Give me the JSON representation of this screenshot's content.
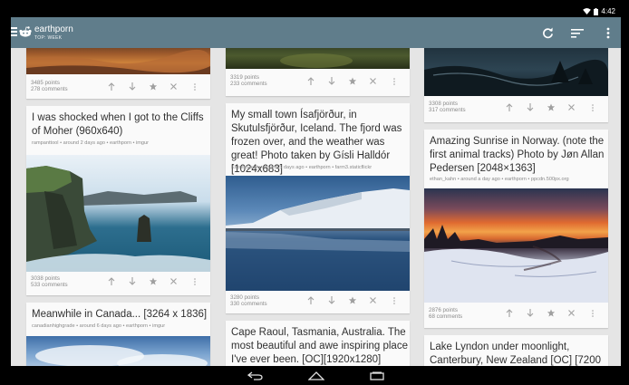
{
  "status": {
    "time": "4:42"
  },
  "appbar": {
    "title": "earthporn",
    "subtitle": "TOP: WEEK"
  },
  "colors": {
    "appbar": "#607d8b",
    "card": "#fafafa",
    "background": "#e5e5e5",
    "text": "#303030",
    "muted": "#8a8a8a"
  },
  "icons": [
    "menu-icon",
    "reddit-alien-icon",
    "refresh-icon",
    "sort-icon",
    "overflow-menu-icon",
    "upvote-icon",
    "downvote-icon",
    "star-icon",
    "close-icon",
    "more-icon",
    "back-icon",
    "home-icon",
    "recents-icon",
    "wifi-icon",
    "battery-icon"
  ],
  "posts": [
    {
      "points": "3485 points",
      "comments": "278 comments"
    },
    {
      "title": "I was shocked when I got to the Cliffs of Moher (960x640)",
      "meta": "rampanttool • around 2 days ago • earthporn • imgur",
      "points": "3038 points",
      "comments": "533 comments"
    },
    {
      "title": "Meanwhile in Canada... [3264 x 1836]",
      "meta": "canadianhighgrade • around 6 days ago • earthporn • imgur"
    },
    {
      "points": "3319 points",
      "comments": "233 comments"
    },
    {
      "title": "My small town Ísafjörður, in Skutulsfjörður, Iceland. The fjord was frozen over, and the weather was great! Photo taken by Gísli Halldór [1024x683]",
      "meta": "KaiserGauti • around 5 days ago • earthporn • farm3.staticflickr",
      "points": "3280 points",
      "comments": "330 comments"
    },
    {
      "title": "Cape Raoul, Tasmania, Australia. The most beautiful and awe inspiring place I've ever been. [OC][1920x1280]"
    },
    {
      "points": "3308 points",
      "comments": "317 comments"
    },
    {
      "title": "Amazing Sunrise in Norway. (note the first animal tracks) Photo by Jøn Allan Pedersen [2048×1363]",
      "meta": "ethan_kahn • around a day ago • earthporn • ppcdn.500px.org",
      "points": "2876 points",
      "comments": "68 comments"
    },
    {
      "title": "Lake Lyndon under moonlight, Canterbury, New Zealand [OC] [7200 x 4297]"
    }
  ]
}
